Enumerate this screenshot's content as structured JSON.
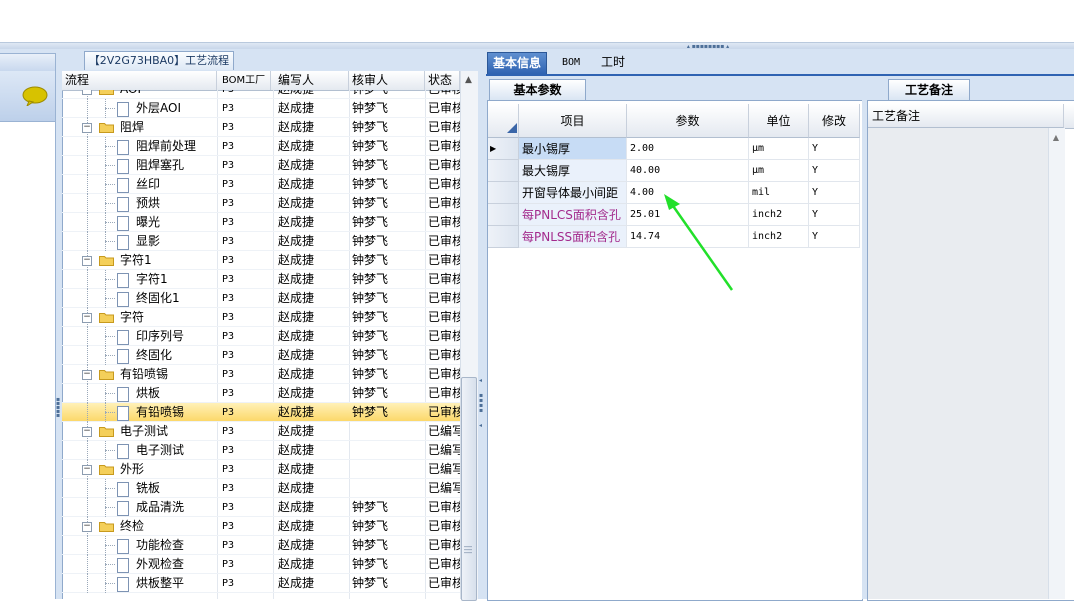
{
  "process_tab": "【2V2G73HBA0】工艺流程",
  "tree": {
    "headers": {
      "name": "流程",
      "bom": "BOM工厂",
      "writer": "编写人",
      "checker": "核审人",
      "status": "状态"
    },
    "rows": [
      {
        "level": 1,
        "type": "folder",
        "name": "AOI",
        "bom": "P3",
        "writer": "赵成捷",
        "checker": "钟梦飞",
        "status": "已审核"
      },
      {
        "level": 2,
        "type": "doc",
        "name": "外层AOI",
        "bom": "P3",
        "writer": "赵成捷",
        "checker": "钟梦飞",
        "status": "已审核"
      },
      {
        "level": 1,
        "type": "folder",
        "name": "阻焊",
        "bom": "P3",
        "writer": "赵成捷",
        "checker": "钟梦飞",
        "status": "已审核"
      },
      {
        "level": 2,
        "type": "doc",
        "name": "阻焊前处理",
        "bom": "P3",
        "writer": "赵成捷",
        "checker": "钟梦飞",
        "status": "已审核"
      },
      {
        "level": 2,
        "type": "doc",
        "name": "阻焊塞孔",
        "bom": "P3",
        "writer": "赵成捷",
        "checker": "钟梦飞",
        "status": "已审核"
      },
      {
        "level": 2,
        "type": "doc",
        "name": "丝印",
        "bom": "P3",
        "writer": "赵成捷",
        "checker": "钟梦飞",
        "status": "已审核"
      },
      {
        "level": 2,
        "type": "doc",
        "name": "预烘",
        "bom": "P3",
        "writer": "赵成捷",
        "checker": "钟梦飞",
        "status": "已审核"
      },
      {
        "level": 2,
        "type": "doc",
        "name": "曝光",
        "bom": "P3",
        "writer": "赵成捷",
        "checker": "钟梦飞",
        "status": "已审核"
      },
      {
        "level": 2,
        "type": "doc",
        "name": "显影",
        "bom": "P3",
        "writer": "赵成捷",
        "checker": "钟梦飞",
        "status": "已审核"
      },
      {
        "level": 1,
        "type": "folder",
        "name": "字符1",
        "bom": "P3",
        "writer": "赵成捷",
        "checker": "钟梦飞",
        "status": "已审核"
      },
      {
        "level": 2,
        "type": "doc",
        "name": "字符1",
        "bom": "P3",
        "writer": "赵成捷",
        "checker": "钟梦飞",
        "status": "已审核"
      },
      {
        "level": 2,
        "type": "doc",
        "name": "终固化1",
        "bom": "P3",
        "writer": "赵成捷",
        "checker": "钟梦飞",
        "status": "已审核"
      },
      {
        "level": 1,
        "type": "folder",
        "name": "字符",
        "bom": "P3",
        "writer": "赵成捷",
        "checker": "钟梦飞",
        "status": "已审核"
      },
      {
        "level": 2,
        "type": "doc",
        "name": "印序列号",
        "bom": "P3",
        "writer": "赵成捷",
        "checker": "钟梦飞",
        "status": "已审核"
      },
      {
        "level": 2,
        "type": "doc",
        "name": "终固化",
        "bom": "P3",
        "writer": "赵成捷",
        "checker": "钟梦飞",
        "status": "已审核"
      },
      {
        "level": 1,
        "type": "folder",
        "name": "有铅喷锡",
        "bom": "P3",
        "writer": "赵成捷",
        "checker": "钟梦飞",
        "status": "已审核"
      },
      {
        "level": 2,
        "type": "doc",
        "name": "烘板",
        "bom": "P3",
        "writer": "赵成捷",
        "checker": "钟梦飞",
        "status": "已审核"
      },
      {
        "level": 2,
        "type": "doc",
        "name": "有铅喷锡",
        "bom": "P3",
        "writer": "赵成捷",
        "checker": "钟梦飞",
        "status": "已审核",
        "selected": true
      },
      {
        "level": 1,
        "type": "folder",
        "name": "电子测试",
        "bom": "P3",
        "writer": "赵成捷",
        "checker": "",
        "status": "已编写"
      },
      {
        "level": 2,
        "type": "doc",
        "name": "电子测试",
        "bom": "P3",
        "writer": "赵成捷",
        "checker": "",
        "status": "已编写"
      },
      {
        "level": 1,
        "type": "folder",
        "name": "外形",
        "bom": "P3",
        "writer": "赵成捷",
        "checker": "",
        "status": "已编写"
      },
      {
        "level": 2,
        "type": "doc",
        "name": "铣板",
        "bom": "P3",
        "writer": "赵成捷",
        "checker": "",
        "status": "已编写"
      },
      {
        "level": 2,
        "type": "doc",
        "name": "成品清洗",
        "bom": "P3",
        "writer": "赵成捷",
        "checker": "钟梦飞",
        "status": "已审核"
      },
      {
        "level": 1,
        "type": "folder",
        "name": "终检",
        "bom": "P3",
        "writer": "赵成捷",
        "checker": "钟梦飞",
        "status": "已审核"
      },
      {
        "level": 2,
        "type": "doc",
        "name": "功能检查",
        "bom": "P3",
        "writer": "赵成捷",
        "checker": "钟梦飞",
        "status": "已审核"
      },
      {
        "level": 2,
        "type": "doc",
        "name": "外观检查",
        "bom": "P3",
        "writer": "赵成捷",
        "checker": "钟梦飞",
        "status": "已审核"
      },
      {
        "level": 2,
        "type": "doc",
        "name": "烘板整平",
        "bom": "P3",
        "writer": "赵成捷",
        "checker": "钟梦飞",
        "status": "已审核"
      }
    ]
  },
  "main_tabs": [
    {
      "label": "基本信息",
      "active": true
    },
    {
      "label": "BOM",
      "active": false
    },
    {
      "label": "工时",
      "active": false
    }
  ],
  "param_panel": {
    "tab": "基本参数",
    "headers": {
      "item": "项目",
      "value": "参数",
      "unit": "单位",
      "edit": "修改"
    },
    "rows": [
      {
        "item": "最小锡厚",
        "value": "2.00",
        "unit": "μm",
        "edit": "Y",
        "current": true
      },
      {
        "item": "最大锡厚",
        "value": "40.00",
        "unit": "μm",
        "edit": "Y"
      },
      {
        "item": "开窗导体最小间距",
        "value": "4.00",
        "unit": "mil",
        "edit": "Y"
      },
      {
        "item": "每PNLCS面积含孔",
        "value": "25.01",
        "unit": "inch2",
        "edit": "Y",
        "highlight": true
      },
      {
        "item": "每PNLSS面积含孔",
        "value": "14.74",
        "unit": "inch2",
        "edit": "Y",
        "highlight": true
      }
    ]
  },
  "note_panel": {
    "tab": "工艺备注",
    "header": "工艺备注"
  },
  "colors": {
    "accent": "#2f63b2",
    "panel_bg": "#d6e3f3",
    "selected_row": "#fcd86a",
    "magenta_text": "#a32a8c",
    "annotation_arrow": "#22e02a"
  },
  "icons": [
    "chat-bubble-icon",
    "folder-icon",
    "document-icon",
    "expander-icon",
    "row-pointer-icon",
    "scroll-up-icon",
    "sort-corner-icon"
  ]
}
